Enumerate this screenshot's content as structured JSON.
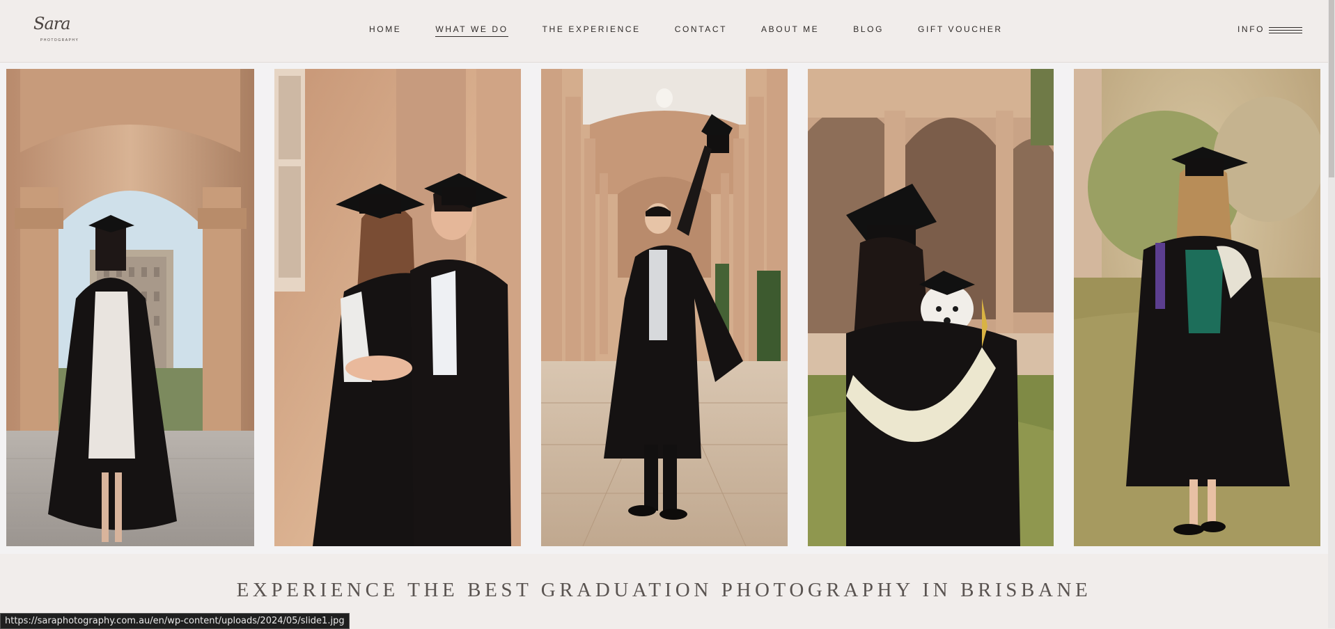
{
  "brand": {
    "logo_script": "Sara",
    "logo_sub": "PHOTOGRAPHY"
  },
  "nav": {
    "items": [
      {
        "label": "HOME",
        "active": false
      },
      {
        "label": "WHAT WE DO",
        "active": true
      },
      {
        "label": "THE EXPERIENCE",
        "active": false
      },
      {
        "label": "CONTACT",
        "active": false
      },
      {
        "label": "ABOUT ME",
        "active": false
      },
      {
        "label": "BLOG",
        "active": false
      },
      {
        "label": "GIFT VOUCHER",
        "active": false
      }
    ],
    "info_label": "INFO",
    "menu_icon": "hamburger-icon"
  },
  "gallery": {
    "photos": [
      {
        "subject": "graduate-under-arch"
      },
      {
        "subject": "graduate-couple-embrace"
      },
      {
        "subject": "graduate-throwing-cap"
      },
      {
        "subject": "graduate-with-dog"
      },
      {
        "subject": "graduate-holding-scroll"
      }
    ]
  },
  "main": {
    "headline": "EXPERIENCE THE BEST GRADUATION PHOTOGRAPHY IN BRISBANE"
  },
  "status_bar": {
    "url": "https://saraphotography.com.au/en/wp-content/uploads/2024/05/slide1.jpg"
  },
  "colors": {
    "background": "#f1edeb",
    "text": "#2e2a28",
    "sandstone": "#c99c77",
    "gown": "#151212"
  }
}
